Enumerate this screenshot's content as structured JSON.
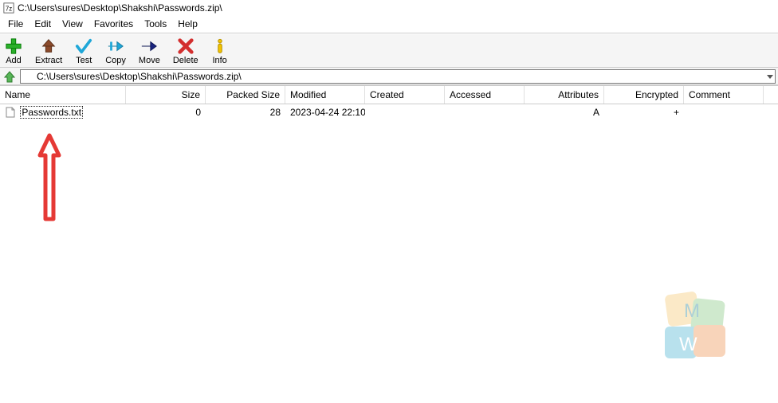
{
  "app_icon": "7z-icon",
  "title": "C:\\Users\\sures\\Desktop\\Shakshi\\Passwords.zip\\",
  "menu": {
    "file": "File",
    "edit": "Edit",
    "view": "View",
    "favorites": "Favorites",
    "tools": "Tools",
    "help": "Help"
  },
  "toolbar": {
    "add": "Add",
    "extract": "Extract",
    "test": "Test",
    "copy": "Copy",
    "move": "Move",
    "delete": "Delete",
    "info": "Info"
  },
  "address": {
    "value": "C:\\Users\\sures\\Desktop\\Shakshi\\Passwords.zip\\"
  },
  "columns": {
    "name": "Name",
    "size": "Size",
    "psize": "Packed Size",
    "modified": "Modified",
    "created": "Created",
    "accessed": "Accessed",
    "attributes": "Attributes",
    "encrypted": "Encrypted",
    "comment": "Comment"
  },
  "rows": [
    {
      "name": "Passwords.txt",
      "size": "0",
      "psize": "28",
      "modified": "2023-04-24 22:10",
      "created": "",
      "accessed": "",
      "attributes": "A",
      "encrypted": "+",
      "comment": ""
    }
  ]
}
